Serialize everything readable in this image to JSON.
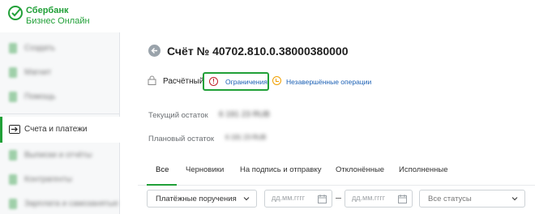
{
  "brand": {
    "line1": "Сбербанк",
    "line2": "Бизнес Онлайн",
    "color": "#21a038"
  },
  "sidebar": {
    "items": [
      {
        "label": "Создать",
        "blurred": true
      },
      {
        "label": "Магнит",
        "blurred": true
      },
      {
        "label": "Помощь",
        "blurred": true
      },
      {
        "label": "Счета и платежи",
        "blurred": false,
        "active": true,
        "icon": "arrow-in-icon"
      },
      {
        "label": "Выписки и отчёты",
        "blurred": true
      },
      {
        "label": "Контрагенты",
        "blurred": true
      },
      {
        "label": "Зарплата и самозанятые",
        "blurred": true
      }
    ]
  },
  "account": {
    "title": "Счёт № 40702.810.0.38000380000",
    "status": "Расчётный",
    "restrictions_link": "Ограничения",
    "pending_link": "Незавершённые операции"
  },
  "balances": {
    "current_label": "Текущий остаток",
    "current_value": "6 191 23 RUB",
    "planned_label": "Плановый остаток",
    "planned_value": "6 191 23 RUB"
  },
  "tabs": [
    "Все",
    "Черновики",
    "На подпись и отправку",
    "Отклонённые",
    "Исполненные"
  ],
  "filters": {
    "doc_type": "Платёжные поручения",
    "date_from_placeholder": "дд.мм.гггг",
    "date_to_placeholder": "дд.мм.гггг",
    "status": "Все статусы"
  },
  "colors": {
    "accent": "#21a038",
    "link": "#1a5fb4",
    "warning": "#c0202b",
    "pending": "#f0a000"
  }
}
